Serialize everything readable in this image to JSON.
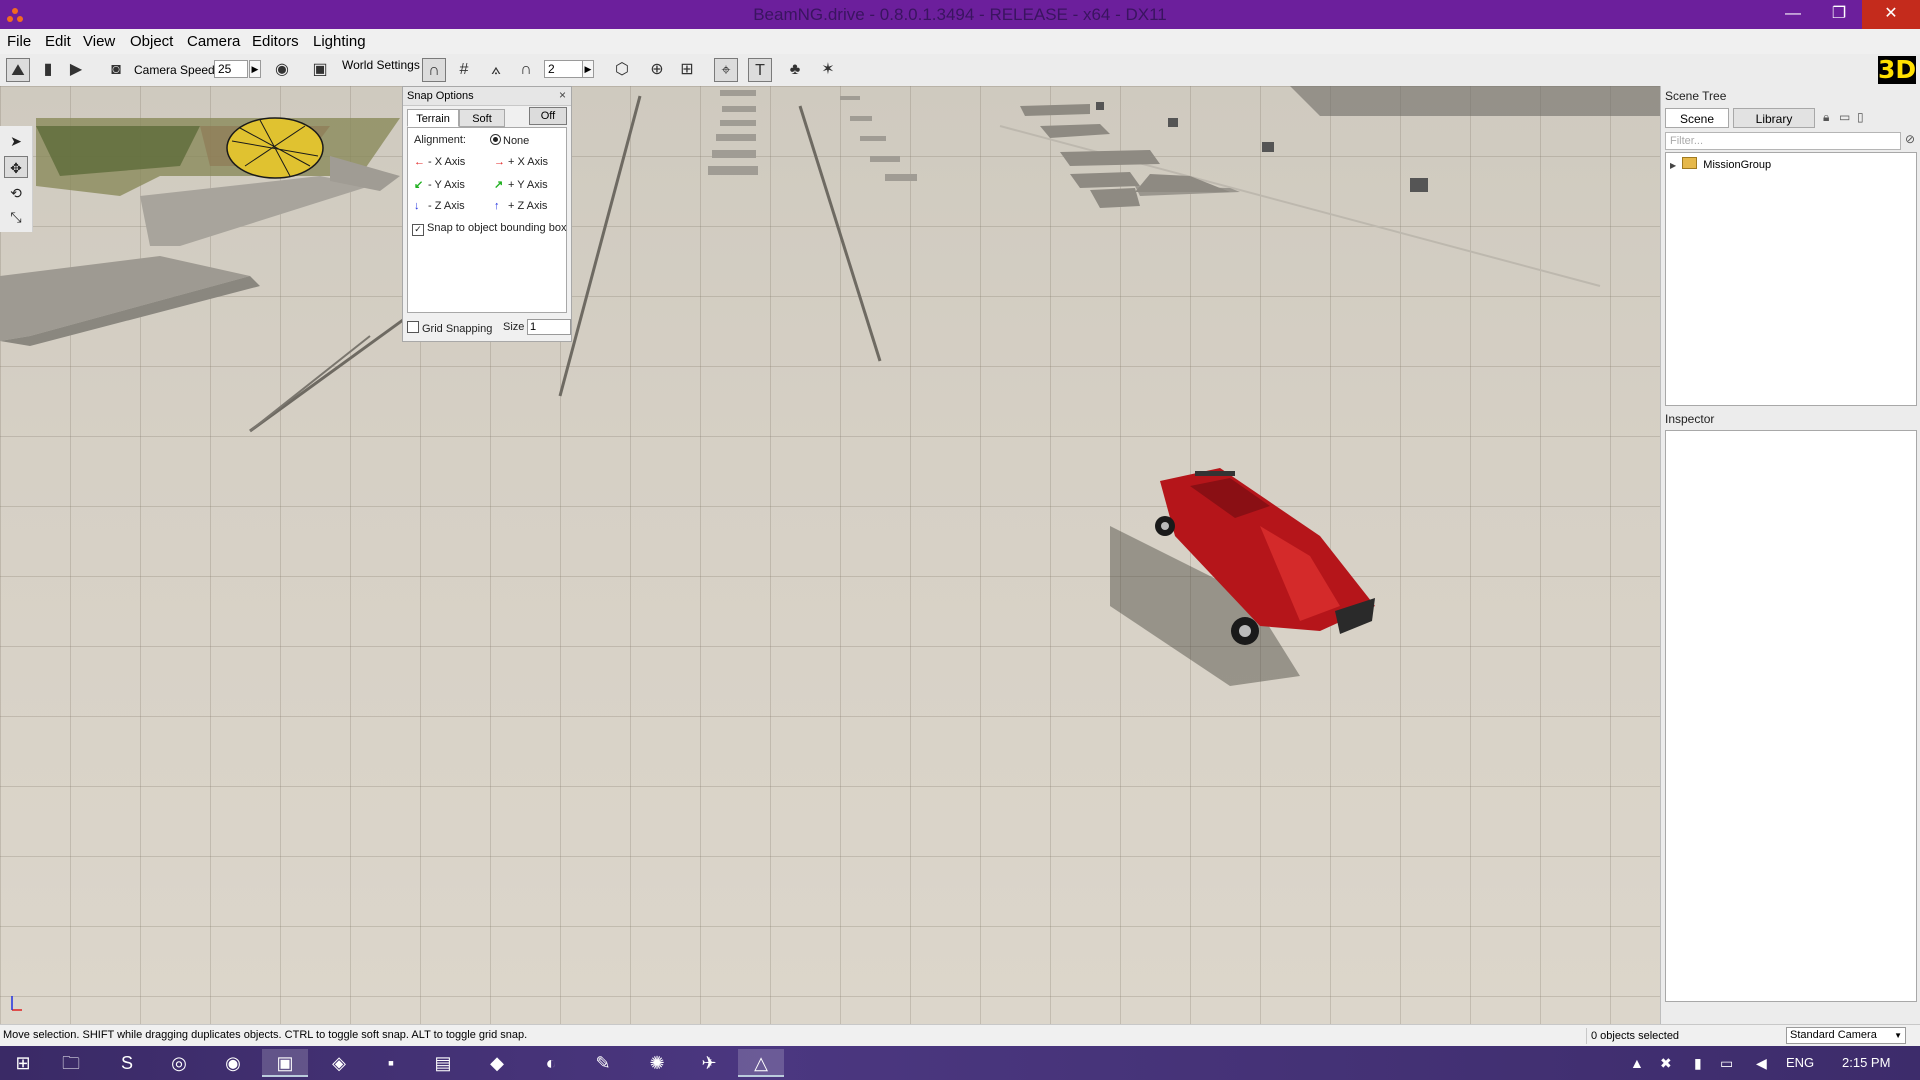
{
  "titlebar": {
    "title": "BeamNG.drive - 0.8.0.1.3494 - RELEASE - x64 - DX11",
    "minimize": "—",
    "maximize": "❐",
    "close": "✕"
  },
  "menubar": {
    "items": [
      "File",
      "Edit",
      "View",
      "Object",
      "Camera",
      "Editors",
      "Lighting"
    ]
  },
  "toolbar": {
    "camera_speed_label": "Camera Speed",
    "camera_speed_value": "25",
    "world_settings_label": "World Settings",
    "snap_value": "2",
    "badge": "3D"
  },
  "snap_options": {
    "title": "Snap Options",
    "close": "×",
    "tabs": [
      "Terrain",
      "Soft"
    ],
    "off_button": "Off",
    "alignment_label": "Alignment:",
    "alignment_none": "None",
    "axes": {
      "neg_x": "- X Axis",
      "pos_x": "+ X Axis",
      "neg_y": "- Y Axis",
      "pos_y": "+ Y Axis",
      "neg_z": "- Z Axis",
      "pos_z": "+ Z Axis"
    },
    "axis_colors": {
      "x": "#e02020",
      "y": "#20b020",
      "z": "#2030e0"
    },
    "snap_bbox_label": "Snap to object bounding box",
    "grid_snapping_label": "Grid Snapping",
    "size_label": "Size",
    "size_value": "1"
  },
  "scene_tree": {
    "title": "Scene Tree",
    "tabs": [
      "Scene",
      "Library"
    ],
    "filter_placeholder": "Filter...",
    "items": [
      {
        "label": "MissionGroup",
        "icon": "folder-icon"
      }
    ]
  },
  "inspector": {
    "title": "Inspector"
  },
  "statusbar": {
    "message": "Move selection.  SHIFT while dragging duplicates objects.  CTRL to toggle soft snap.  ALT to toggle grid snap.",
    "selection_count": "0 objects selected",
    "camera_mode": "Standard Camera"
  },
  "taskbar": {
    "language": "ENG",
    "time": "2:15 PM"
  }
}
